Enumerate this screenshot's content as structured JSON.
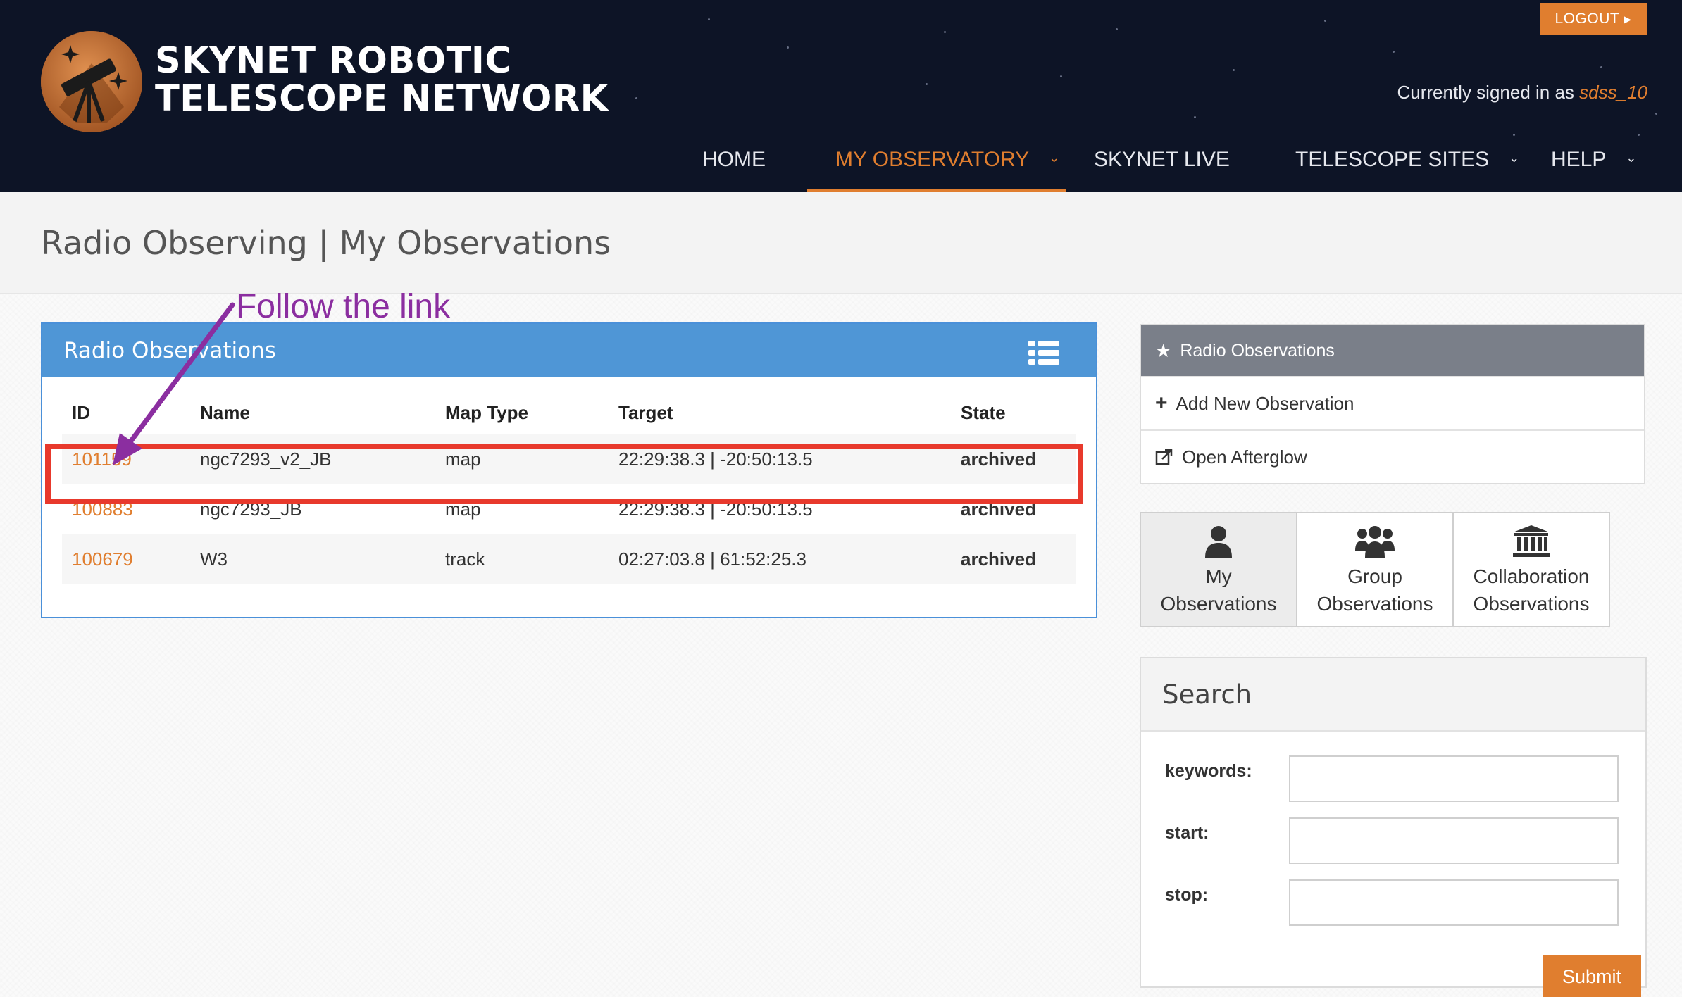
{
  "header": {
    "logo_line1": "SKYNET ROBOTIC",
    "logo_line2": "TELESCOPE NETWORK",
    "logout_label": "LOGOUT",
    "signed_in_prefix": "Currently signed in as ",
    "signed_in_user": "sdss_10",
    "nav": [
      {
        "label": "HOME",
        "active": false,
        "dropdown": false
      },
      {
        "label": "MY OBSERVATORY",
        "active": true,
        "dropdown": true
      },
      {
        "label": "SKYNET LIVE",
        "active": false,
        "dropdown": false
      },
      {
        "label": "TELESCOPE SITES",
        "active": false,
        "dropdown": true
      },
      {
        "label": "HELP",
        "active": false,
        "dropdown": true
      }
    ]
  },
  "page": {
    "title": "Radio Observing | My Observations"
  },
  "observations": {
    "panel_title": "Radio Observations",
    "columns": [
      "ID",
      "Name",
      "Map Type",
      "Target",
      "State"
    ],
    "rows": [
      {
        "id": "101159",
        "name": "ngc7293_v2_JB",
        "map_type": "map",
        "target": "22:29:38.3 | -20:50:13.5",
        "state": "archived"
      },
      {
        "id": "100883",
        "name": "ngc7293_JB",
        "map_type": "map",
        "target": "22:29:38.3 | -20:50:13.5",
        "state": "archived"
      },
      {
        "id": "100679",
        "name": "W3",
        "map_type": "track",
        "target": "02:27:03.8 | 61:52:25.3",
        "state": "archived"
      }
    ]
  },
  "annotation": {
    "text": "Follow the link"
  },
  "sidebar": {
    "head": "Radio Observations",
    "items": [
      {
        "label": "Add New Observation",
        "icon": "plus-icon"
      },
      {
        "label": "Open Afterglow",
        "icon": "external-link-icon"
      }
    ],
    "tiles": [
      {
        "label": "My\nObservations",
        "icon": "user-icon",
        "active": true
      },
      {
        "label": "Group\nObservations",
        "icon": "group-icon",
        "active": false
      },
      {
        "label": "Collaboration\nObservations",
        "icon": "institution-icon",
        "active": false
      }
    ]
  },
  "search": {
    "title": "Search",
    "fields": [
      {
        "label": "keywords:",
        "value": ""
      },
      {
        "label": "start:",
        "value": ""
      },
      {
        "label": "stop:",
        "value": ""
      }
    ],
    "submit_label": "Submit"
  },
  "colors": {
    "accent": "#e07e2f",
    "header_bg": "#0d1426",
    "panel_blue": "#4f96d6",
    "archived_green": "#2fb34e",
    "annotation_red": "#e8392c",
    "annotation_purple": "#8b2ea0"
  }
}
